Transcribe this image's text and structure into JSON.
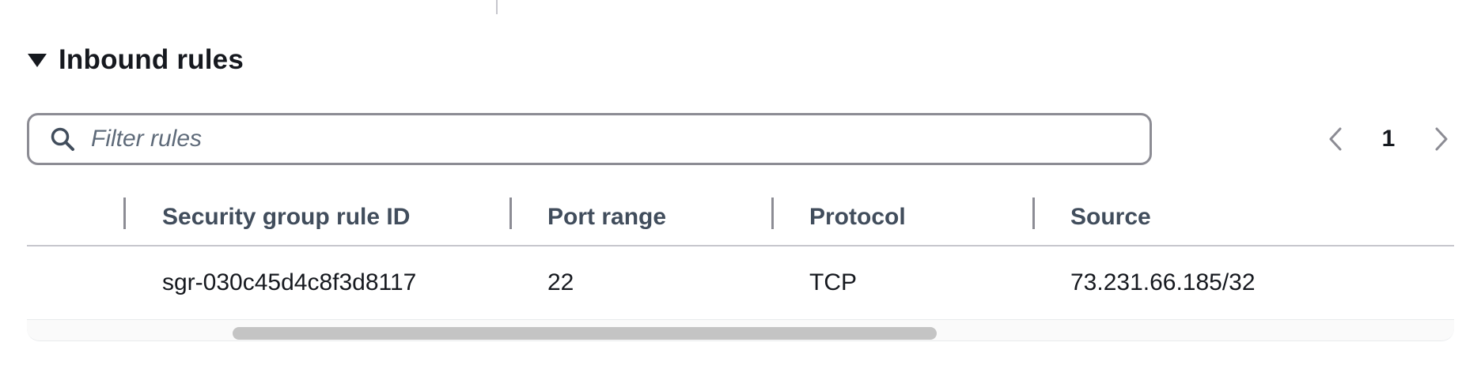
{
  "section": {
    "title": "Inbound rules",
    "caret_icon": "caret-down-icon"
  },
  "filter": {
    "placeholder": "Filter rules",
    "value": "",
    "icon": "search-icon"
  },
  "pagination": {
    "current_page": "1",
    "prev_icon": "chevron-left-icon",
    "next_icon": "chevron-right-icon"
  },
  "table": {
    "columns": [
      "Security group rule ID",
      "Port range",
      "Protocol",
      "Source"
    ],
    "rows": [
      [
        "sgr-030c45d4c8f3d8117",
        "22",
        "TCP",
        "73.231.66.185/32"
      ]
    ]
  },
  "colors": {
    "text": "#16191f",
    "header_text": "#414d5c",
    "border": "#8c8c94",
    "divider": "#c6c6cd"
  }
}
